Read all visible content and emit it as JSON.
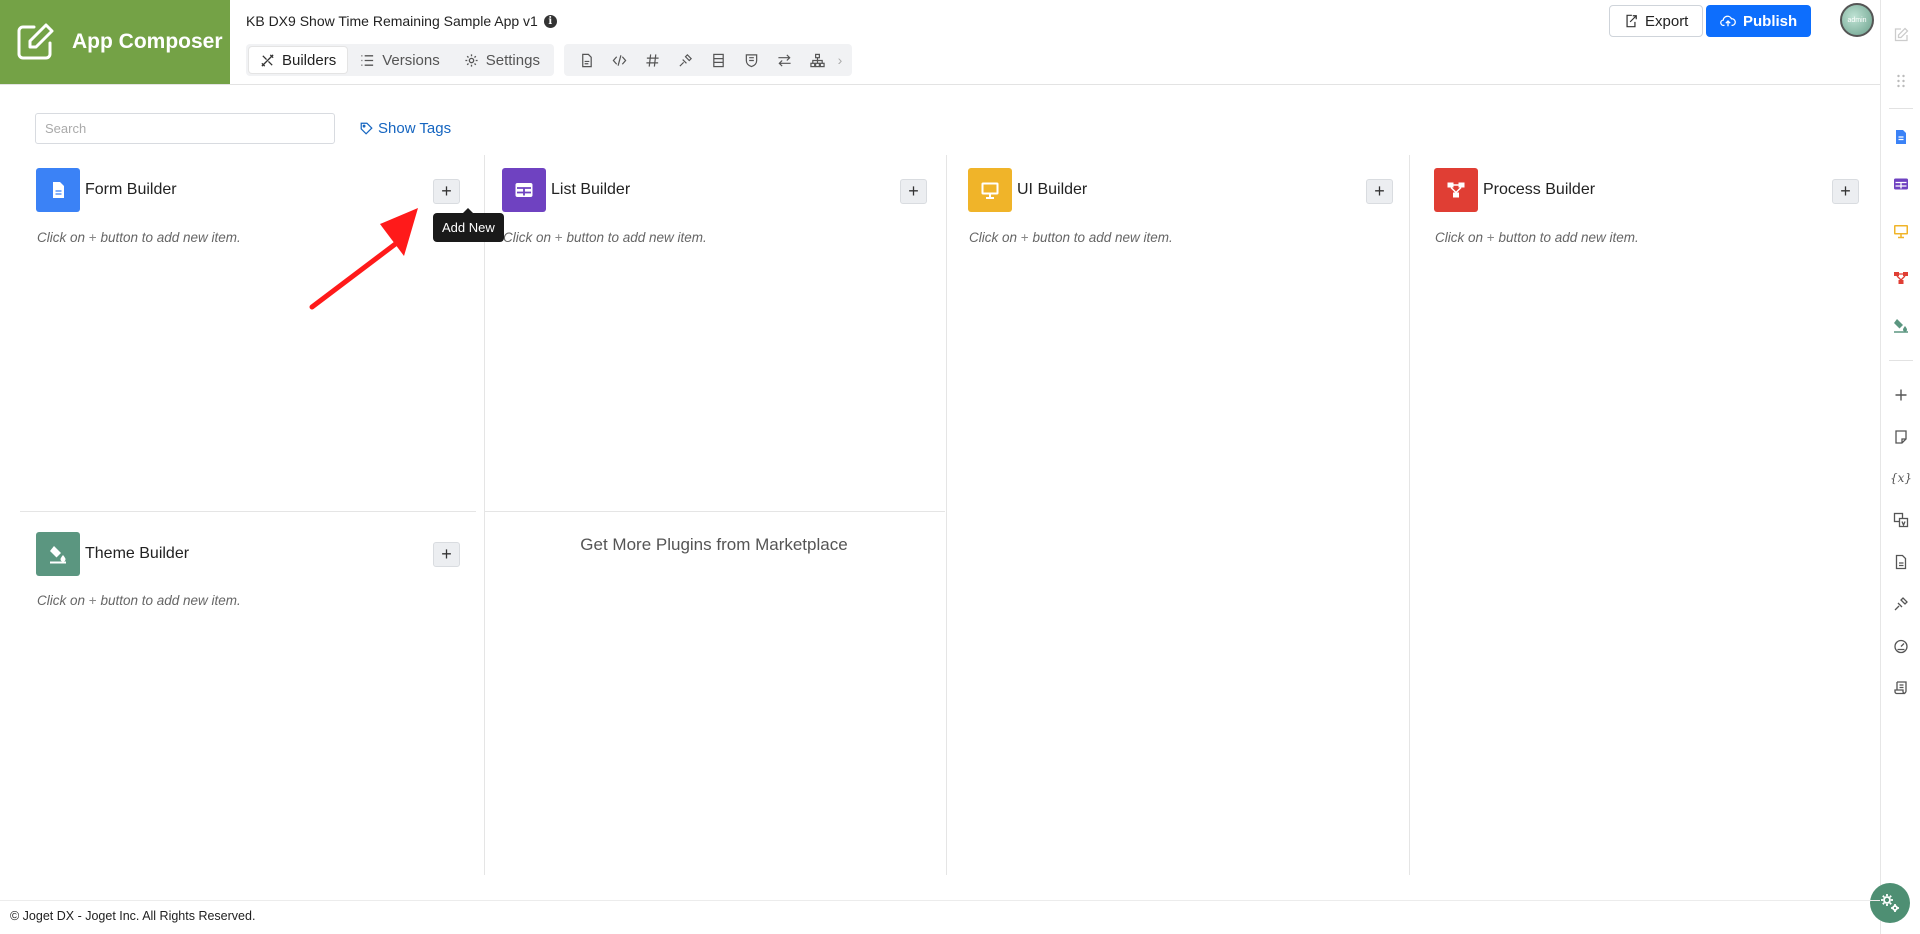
{
  "brand": {
    "name": "App Composer"
  },
  "app": {
    "title": "KB DX9 Show Time Remaining Sample App v1",
    "info_glyph": "i"
  },
  "tabs": [
    {
      "label": "Builders",
      "icon": "builders-icon",
      "active": true
    },
    {
      "label": "Versions",
      "icon": "list-icon",
      "active": false
    },
    {
      "label": "Settings",
      "icon": "gear-icon",
      "active": false
    }
  ],
  "toolbar_icons": [
    "form-icon",
    "code-icon",
    "hash-icon",
    "plugin-icon",
    "datalist-icon",
    "shield-icon",
    "arrows-icon",
    "sitemap-icon"
  ],
  "actions": {
    "export_label": "Export",
    "publish_label": "Publish"
  },
  "avatar": {
    "label": "admin"
  },
  "search": {
    "placeholder": "Search",
    "value": ""
  },
  "show_tags": {
    "label": "Show Tags"
  },
  "hint": {
    "prefix": "Click on",
    "plus": "+",
    "suffix": "button to add new item."
  },
  "builders": [
    {
      "title": "Form Builder",
      "color": "#3b82f6",
      "icon": "form-builder-icon"
    },
    {
      "title": "List Builder",
      "color": "#6f42c1",
      "icon": "list-builder-icon"
    },
    {
      "title": "UI Builder",
      "color": "#f0b429",
      "icon": "ui-builder-icon"
    },
    {
      "title": "Process Builder",
      "color": "#e03e34",
      "icon": "process-builder-icon"
    },
    {
      "title": "Theme Builder",
      "color": "#5b9680",
      "icon": "theme-builder-icon"
    }
  ],
  "add_button": {
    "glyph": "+"
  },
  "tooltip": {
    "text": "Add New"
  },
  "marketplace": {
    "label": "Get More Plugins from Marketplace"
  },
  "footer": {
    "text": "© Joget DX - Joget Inc. All Rights Reserved."
  },
  "colors": {
    "brand_green": "#74a246",
    "publish_blue": "#0d6efd",
    "annotation_red": "#ff1a1a"
  }
}
